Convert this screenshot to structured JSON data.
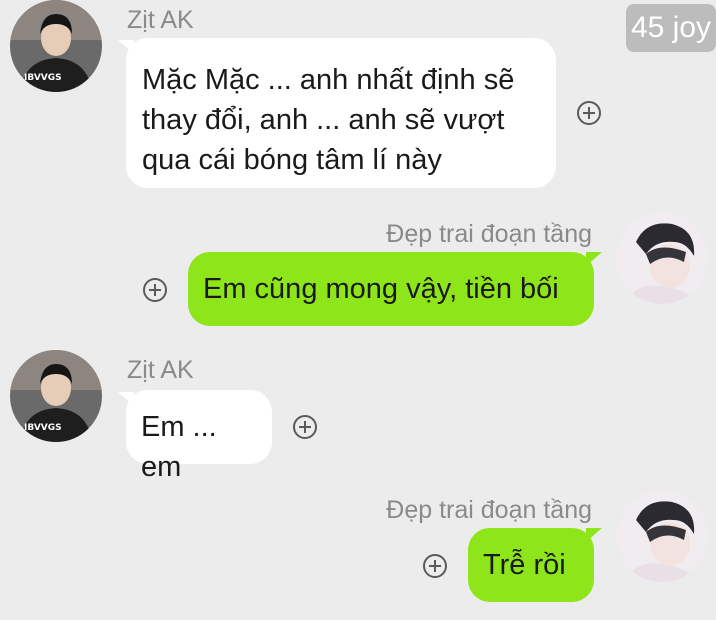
{
  "watermark": "45 joy",
  "sender_left": {
    "name": "Zịt AK",
    "shirt_text": "IBVVGS"
  },
  "sender_right": {
    "name": "Đẹp trai đoạn tầng"
  },
  "messages": [
    {
      "side": "left",
      "sender": "Zịt AK",
      "lines": [
        "Mặc Mặc ... anh nhất định sẽ",
        "thay đổi, anh ... anh sẽ vượt",
        "qua cái bóng tâm lí này"
      ]
    },
    {
      "side": "right",
      "sender": "Đẹp trai đoạn tầng",
      "text": "Em cũng mong vậy, tiền bối"
    },
    {
      "side": "left",
      "sender": "Zịt AK",
      "text": "Em ... em"
    },
    {
      "side": "right",
      "sender": "Đẹp trai đoạn tầng",
      "text": "Trễ rồi"
    }
  ],
  "colors": {
    "background": "#ececec",
    "left_bubble": "#ffffff",
    "right_bubble": "#8ee51a"
  }
}
